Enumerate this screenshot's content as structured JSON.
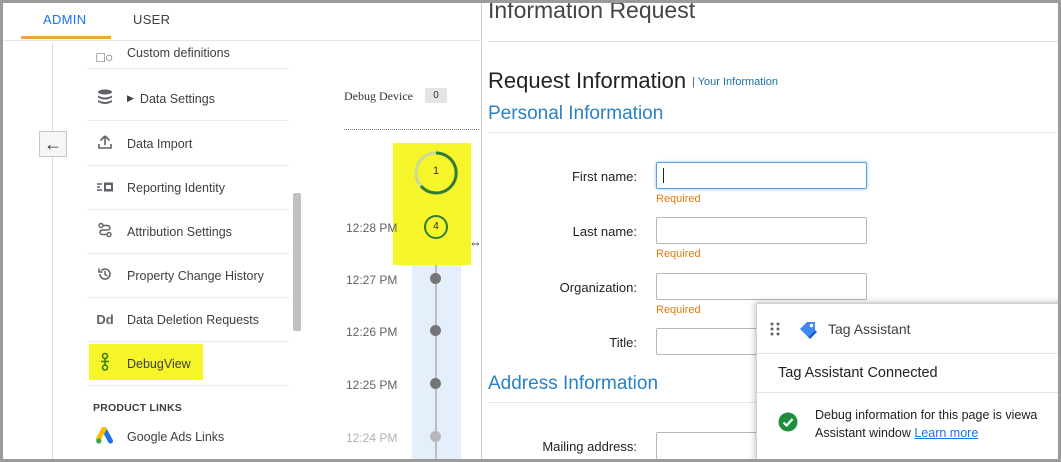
{
  "ga": {
    "tabs": {
      "admin": "ADMIN",
      "user": "USER"
    },
    "nav": {
      "custom_definitions": "Custom definitions",
      "data_settings": "Data Settings",
      "data_import": "Data Import",
      "reporting_identity": "Reporting Identity",
      "attribution_settings": "Attribution Settings",
      "property_change_history": "Property Change History",
      "data_deletion_requests": "Data Deletion Requests",
      "debugview": "DebugView",
      "product_links_heading": "PRODUCT LINKS",
      "google_ads_links": "Google Ads Links"
    },
    "icons": {
      "data_deletion_glyph": "Dd"
    },
    "debug": {
      "device_label": "Debug Device",
      "device_count": "0",
      "event_ring_count": "1",
      "event_badge_count": "4",
      "times": [
        "12:28 PM",
        "12:27 PM",
        "12:26 PM",
        "12:25 PM",
        "12:24 PM"
      ]
    },
    "colors": {
      "accent_blue": "#1a73e8",
      "tab_underline": "#f2a53a",
      "highlight": "#f5f52a",
      "ring_green": "#2e7d32"
    }
  },
  "form": {
    "page_title": "Information Request",
    "heading": "Request Information",
    "heading_sep": "|",
    "heading_link": "Your Information",
    "personal_section": "Personal Information",
    "fields": {
      "first_name": {
        "label": "First name:",
        "value": "",
        "required": "Required"
      },
      "last_name": {
        "label": "Last name:",
        "value": "",
        "required": "Required"
      },
      "organization": {
        "label": "Organization:",
        "value": "",
        "required": "Required"
      },
      "title": {
        "label": "Title:",
        "value": ""
      },
      "mailing_address": {
        "label": "Mailing address:",
        "value": ""
      }
    },
    "address_section": "Address Information",
    "colors": {
      "section_blue": "#2a81c6",
      "required_orange": "#e07b10"
    }
  },
  "tag_assistant": {
    "title": "Tag Assistant",
    "status": "Tag Assistant Connected",
    "message_line1": "Debug information for this page is viewa",
    "message_line2": "Assistant window",
    "learn_more": "Learn more",
    "colors": {
      "check_green": "#1e8e3e"
    }
  }
}
